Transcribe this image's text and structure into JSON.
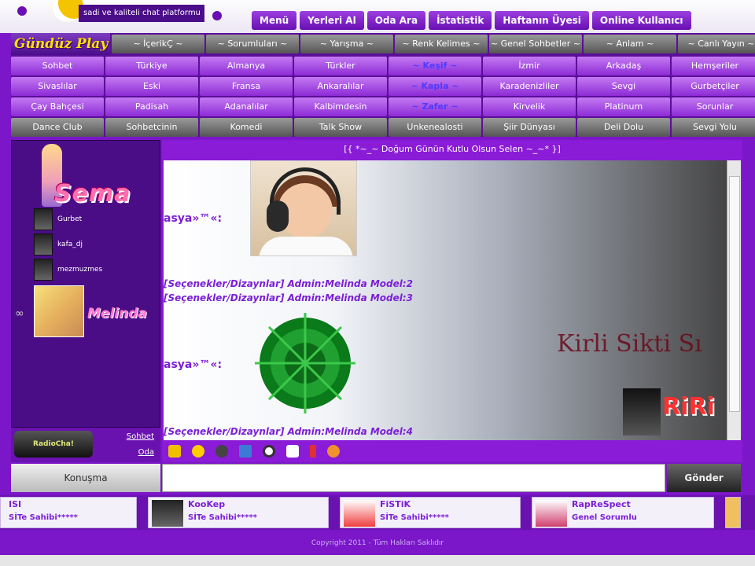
{
  "header": {
    "slogan": "sadi ve kaliteli chat platformu",
    "nav": [
      "Menü",
      "Yerleri Al",
      "Oda Ara",
      "İstatistik",
      "Haftanın Üyesi",
      "Online Kullanıcı"
    ]
  },
  "menu": {
    "brand": "Gündüz Play",
    "rows": [
      [
        "~ İçerikÇ ~",
        "~ Sorumluları ~",
        "~ Yarışma ~",
        "~ Renk Kelimes ~",
        "~ Genel Sohbetler ~",
        "~ Anlam ~",
        "~ Canlı Yayın ~"
      ],
      [
        "Sohbet",
        "Türkiye",
        "Almanya",
        "Türkler",
        "~ Keşif ~",
        "İzmir",
        "Arkadaş",
        "Hemşeriler"
      ],
      [
        "Sivaslılar",
        "Eski",
        "Fransa",
        "Ankaralılar",
        "~ Kapla ~",
        "Karadenizliler",
        "Sevgi",
        "Gurbetçiler"
      ],
      [
        "Çay Bahçesi",
        "Padisah",
        "Adanalılar",
        "Kalbimdesin",
        "~ Zafer ~",
        "Kirvelik",
        "Platinum",
        "Sorunlar"
      ],
      [
        "Dance Club",
        "Sohbetcinin",
        "Komedi",
        "Talk Show",
        "Unkenealosti",
        "Şiir Dünyası",
        "Deli Dolu",
        "Sevgi Yolu"
      ]
    ]
  },
  "sidebar": {
    "logo_text": "Sema",
    "users": [
      "Gurbet",
      "kafa_dj",
      "mezmuzmes"
    ],
    "featured_name": "Melinda",
    "radio_label": "RadioCha!",
    "links": [
      "Sohbet",
      "Oda"
    ],
    "konusma": "Konuşma"
  },
  "chat": {
    "title": "[{  *~_~ Doğum Günün Kutlu Olsun Selen ~_~*  }]",
    "sender": "asya»™«:",
    "system_lines": [
      "[Seçenekler/Dizaynlar] Admin:Melinda Model:2",
      "[Seçenekler/Dizaynlar] Admin:Melinda Model:3",
      "[Seçenekler/Dizaynlar] Admin:Melinda Model:4"
    ],
    "watermark": "Kirli Sikti Sı",
    "riri": "RiRi"
  },
  "input": {
    "placeholder": "",
    "send_label": "Gönder"
  },
  "strip": [
    {
      "name": "ISI",
      "status": "SİTe Sahibi*****"
    },
    {
      "name": "KooKep",
      "status": "SİTe Sahibi*****"
    },
    {
      "name": "FiSTiK",
      "status": "SİTe Sahibi*****"
    },
    {
      "name": "RapReSpect",
      "status": "Genel Sorumlu"
    }
  ],
  "footer": "Copyright 2011 - Tüm Hakları Saklıdır"
}
